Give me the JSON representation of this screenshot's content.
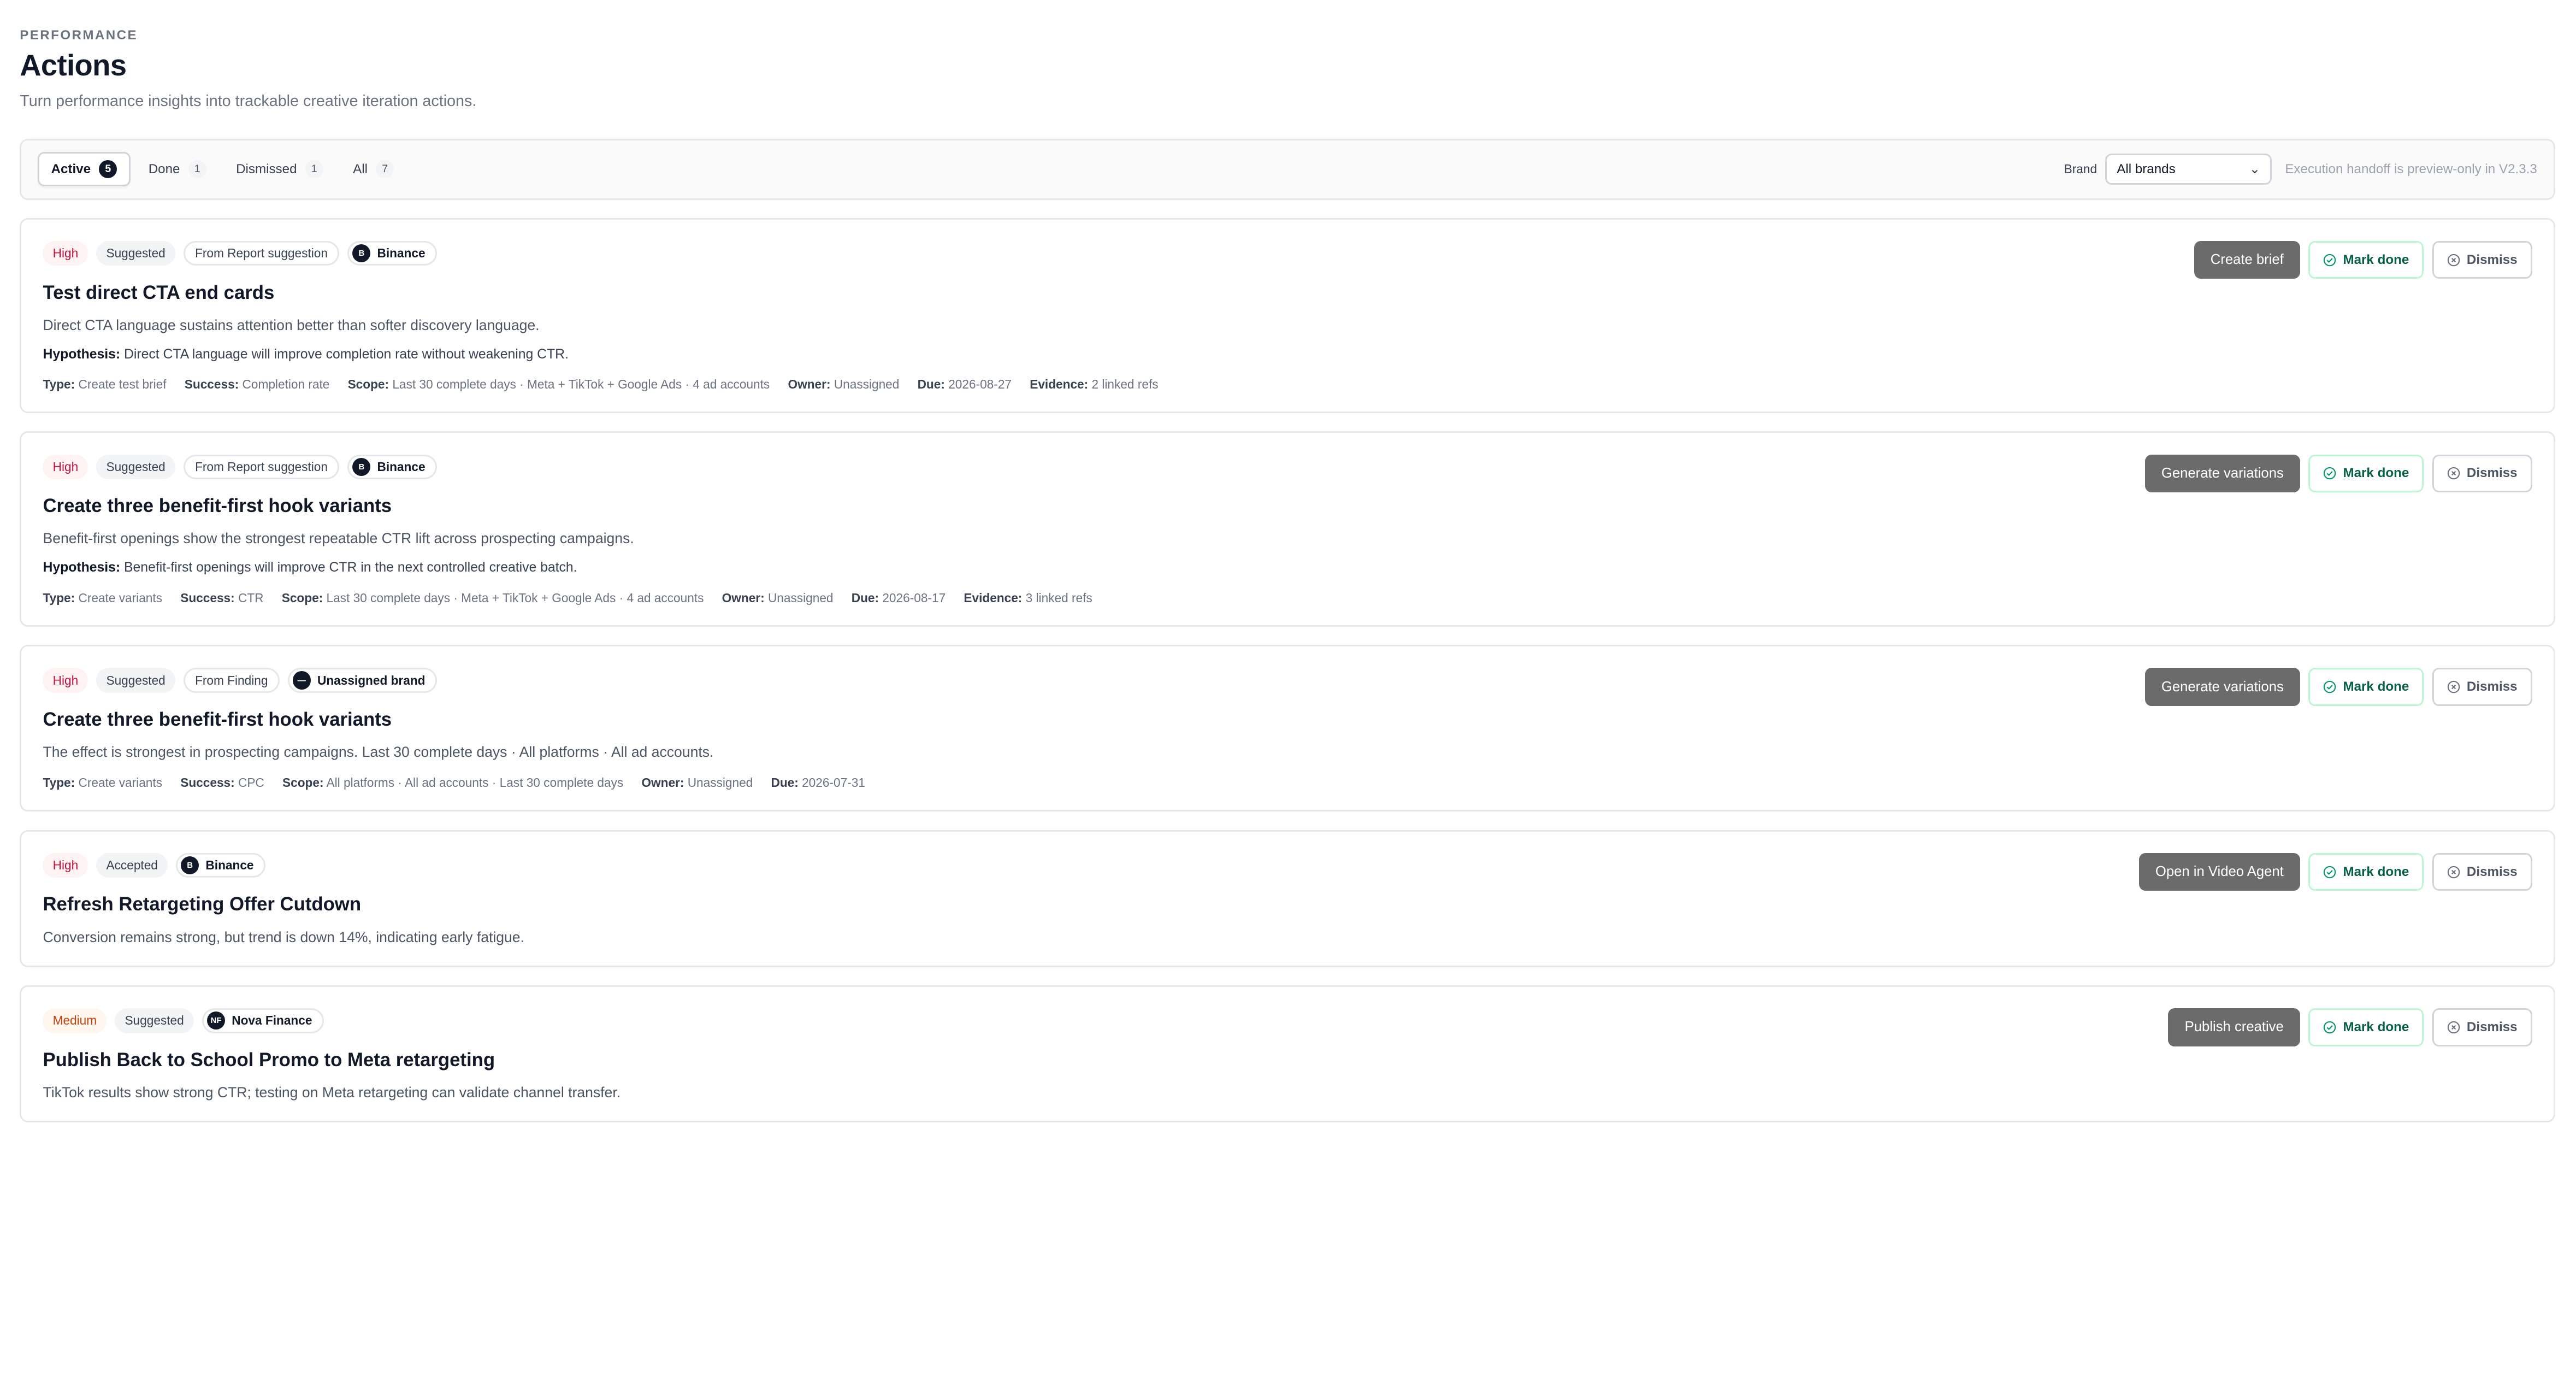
{
  "header": {
    "eyebrow": "PERFORMANCE",
    "title": "Actions",
    "subtitle": "Turn performance insights into trackable creative iteration actions."
  },
  "filters": {
    "tabs": [
      {
        "label": "Active",
        "count": "5"
      },
      {
        "label": "Done",
        "count": "1"
      },
      {
        "label": "Dismissed",
        "count": "1"
      },
      {
        "label": "All",
        "count": "7"
      }
    ],
    "brand_label": "Brand",
    "brand_value": "All brands",
    "preview_note": "Execution handoff is preview-only in V2.3.3"
  },
  "labels": {
    "mark_done": "Mark done",
    "dismiss": "Dismiss",
    "hypothesis": "Hypothesis:",
    "type": "Type:",
    "success": "Success:",
    "scope": "Scope:",
    "owner": "Owner:",
    "due": "Due:",
    "evidence": "Evidence:"
  },
  "actions": [
    {
      "priority": "High",
      "status": "Suggested",
      "source": "From Report suggestion",
      "brand_initials": "B",
      "brand": "Binance",
      "title": "Test direct CTA end cards",
      "description": "Direct CTA language sustains attention better than softer discovery language.",
      "hypothesis": "Direct CTA language will improve completion rate without weakening CTR.",
      "primary_action": "Create brief",
      "meta": {
        "type": "Create test brief",
        "success": "Completion rate",
        "scope": "Last 30 complete days · Meta + TikTok + Google Ads · 4 ad accounts",
        "owner": "Unassigned",
        "due": "2026-08-27",
        "evidence": "2 linked refs"
      }
    },
    {
      "priority": "High",
      "status": "Suggested",
      "source": "From Report suggestion",
      "brand_initials": "B",
      "brand": "Binance",
      "title": "Create three benefit-first hook variants",
      "description": "Benefit-first openings show the strongest repeatable CTR lift across prospecting campaigns.",
      "hypothesis": "Benefit-first openings will improve CTR in the next controlled creative batch.",
      "primary_action": "Generate variations",
      "meta": {
        "type": "Create variants",
        "success": "CTR",
        "scope": "Last 30 complete days · Meta + TikTok + Google Ads · 4 ad accounts",
        "owner": "Unassigned",
        "due": "2026-08-17",
        "evidence": "3 linked refs"
      }
    },
    {
      "priority": "High",
      "status": "Suggested",
      "source": "From Finding",
      "brand_initials": "—",
      "brand": "Unassigned brand",
      "title": "Create three benefit-first hook variants",
      "description": "The effect is strongest in prospecting campaigns. Last 30 complete days · All platforms · All ad accounts.",
      "primary_action": "Generate variations",
      "meta": {
        "type": "Create variants",
        "success": "CPC",
        "scope": "All platforms · All ad accounts · Last 30 complete days",
        "owner": "Unassigned",
        "due": "2026-07-31"
      }
    },
    {
      "priority": "High",
      "status": "Accepted",
      "brand_initials": "B",
      "brand": "Binance",
      "title": "Refresh Retargeting Offer Cutdown",
      "description": "Conversion remains strong, but trend is down 14%, indicating early fatigue.",
      "primary_action": "Open in Video Agent"
    },
    {
      "priority": "Medium",
      "status": "Suggested",
      "brand_initials": "NF",
      "brand": "Nova Finance",
      "title": "Publish Back to School Promo to Meta retargeting",
      "description": "TikTok results show strong CTR; testing on Meta retargeting can validate channel transfer.",
      "primary_action": "Publish creative"
    }
  ]
}
